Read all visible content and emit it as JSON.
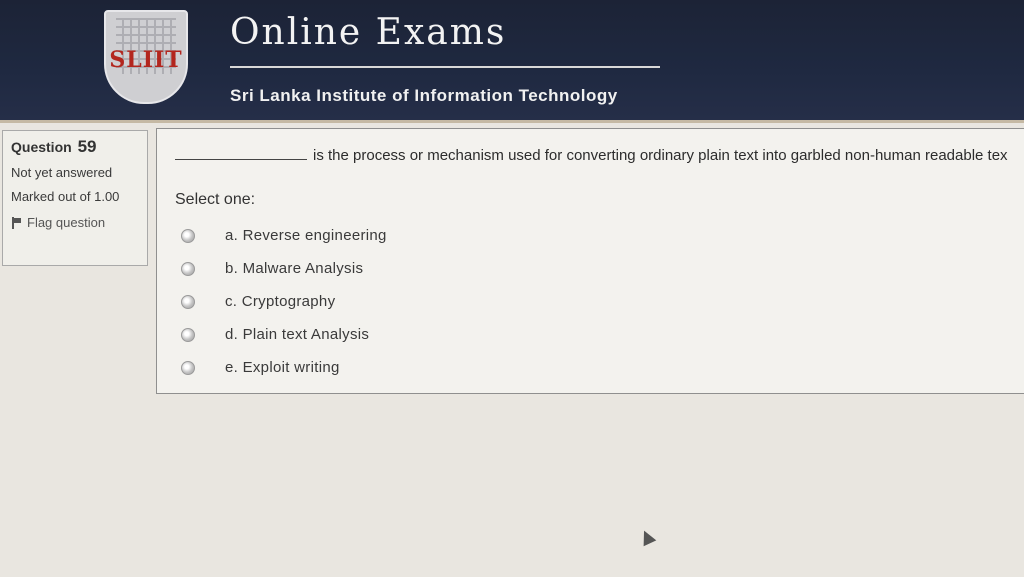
{
  "header": {
    "logo_text": "SLIIT",
    "title": "Online Exams",
    "subtitle": "Sri Lanka Institute of Information Technology"
  },
  "question_info": {
    "label": "Question",
    "number": "59",
    "state": "Not yet answered",
    "marked_out_of": "Marked out of 1.00",
    "flag_label": "Flag question"
  },
  "question": {
    "text": "is the process or mechanism used for converting ordinary plain text into garbled non-human readable tex",
    "select_label": "Select one:",
    "options": [
      {
        "label": "a. Reverse engineering"
      },
      {
        "label": "b. Malware Analysis"
      },
      {
        "label": "c. Cryptography"
      },
      {
        "label": "d. Plain text Analysis"
      },
      {
        "label": "e. Exploit writing"
      }
    ]
  }
}
